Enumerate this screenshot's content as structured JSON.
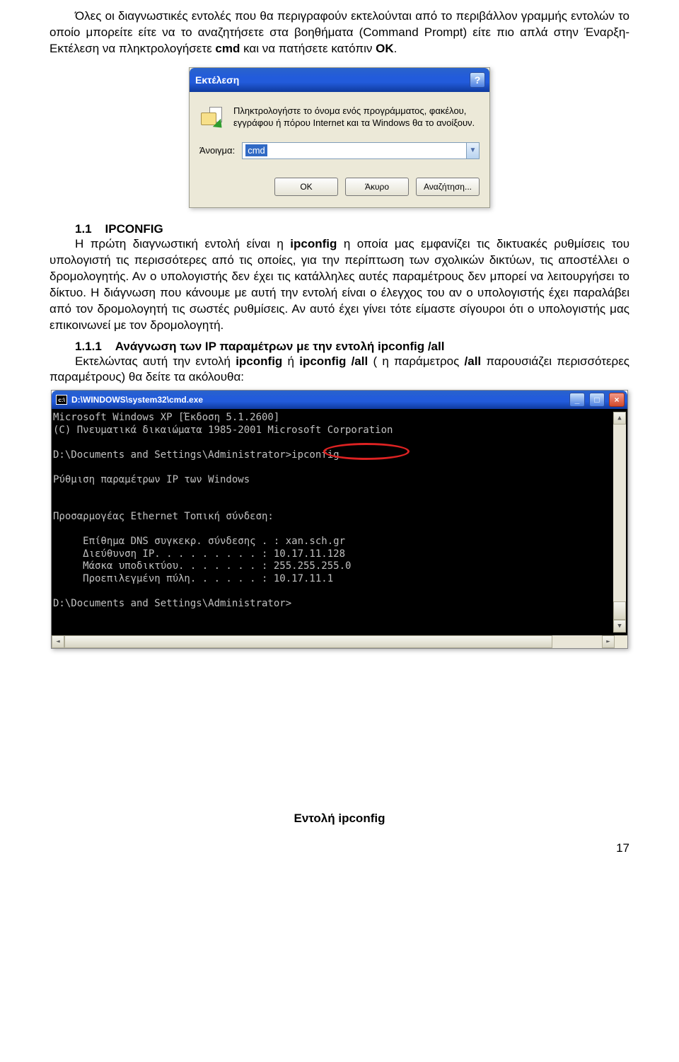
{
  "para_intro": "Όλες οι διαγνωστικές εντολές που θα περιγραφούν εκτελούνται από το περιβάλλον γραμμής εντολών το οποίο μπορείτε είτε να το αναζητήσετε στα βοηθήματα (Command Prompt) είτε πιο απλά στην Έναρξη-Εκτέλεση να πληκτρολογήσετε ",
  "cmd_word": "cmd",
  "para_intro2": " και να πατήσετε κατόπιν ",
  "ok_word": "OK",
  "para_intro3": ".",
  "run": {
    "title": "Εκτέλεση",
    "help": "?",
    "desc": "Πληκτρολογήστε το όνομα ενός προγράμματος, φακέλου, εγγράφου ή πόρου Internet και τα Windows θα το ανοίξουν.",
    "open_label": "Άνοιγμα:",
    "value": "cmd",
    "ok": "OK",
    "cancel": "Άκυρο",
    "browse": "Αναζήτηση..."
  },
  "sec_num": "1.1",
  "sec_title": "IPCONFIG",
  "body1a": "Η πρώτη διαγνωστική εντολή είναι η ",
  "ipconfig_b": "ipconfig",
  "body1b": " η οποία μας εμφανίζει τις δικτυακές ρυθμίσεις του υπολογιστή τις περισσότερες από τις οποίες, για την περίπτωση των σχολικών δικτύων, τις αποστέλλει ο δρομολογητής. Αν ο υπολογιστής δεν έχει τις κατάλληλες αυτές παραμέτρους δεν μπορεί να λειτουργήσει το δίκτυο. Η διάγνωση που κάνουμε με αυτή την εντολή είναι ο έλεγχος του αν ο υπολογιστής έχει παραλάβει από τον δρομολογητή τις σωστές ρυθμίσεις. Αν αυτό έχει γίνει τότε είμαστε σίγουροι ότι ο υπολογιστής μας επικοινωνεί με τον δρομολογητή.",
  "sub_num": "1.1.1",
  "sub_title": "Ανάγνωση των IP παραμέτρων με την εντολή ipconfig /all",
  "body2a": "Εκτελώντας αυτή την εντολή ",
  "body2b": " ή ",
  "ipconfigall_b": "ipconfig /all",
  "body2c": " ( η παράμετρος ",
  "all_b": "/all",
  "body2d": " παρουσιάζει περισσότερες παραμέτρους) θα δείτε τα ακόλουθα:",
  "cmd": {
    "titlebar": "D:\\WINDOWS\\system32\\cmd.exe",
    "line1": "Microsoft Windows XP [Έκδοση 5.1.2600]",
    "line2": "(C) Πνευματικά δικαιώματα 1985-2001 Microsoft Corporation",
    "blank": "",
    "prompt1": "D:\\Documents and Settings\\Administrator>ipconfig",
    "heading": "Ρύθμιση παραμέτρων IP των Windows",
    "adapter": "Προσαρμογέας Ethernet Τοπική σύνδεση:",
    "dns": "     Επίθημα DNS συγκεκρ. σύνδεσης . : xan.sch.gr",
    "ip": "     Διεύθυνση IP. . . . . . . . . : 10.17.11.128",
    "mask": "     Μάσκα υποδικτύου. . . . . . . : 255.255.255.0",
    "gw": "     Προεπιλεγμένη πύλη. . . . . . : 10.17.11.1",
    "prompt2": "D:\\Documents and Settings\\Administrator>"
  },
  "caption": "Εντολή ipconfig",
  "pagenum": "17"
}
